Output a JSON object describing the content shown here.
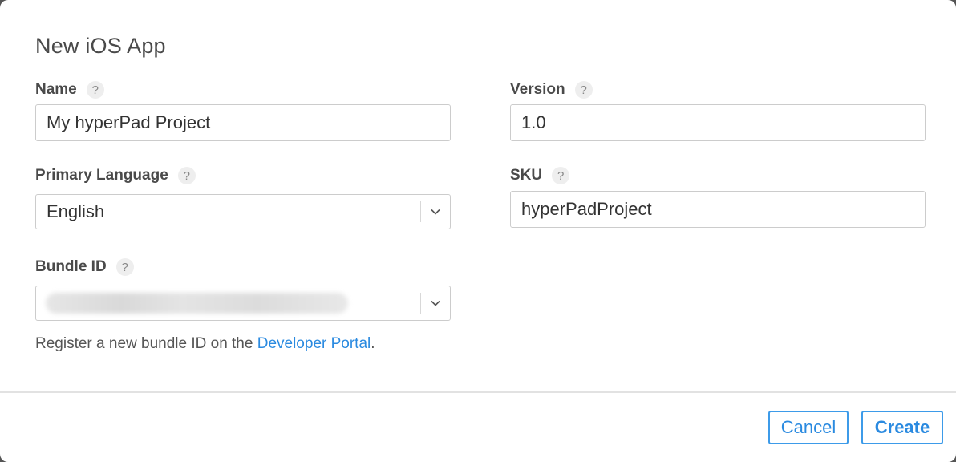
{
  "dialog": {
    "title": "New iOS App"
  },
  "fields": {
    "name": {
      "label": "Name",
      "help": "?",
      "value": "My hyperPad Project"
    },
    "version": {
      "label": "Version",
      "help": "?",
      "value": "1.0"
    },
    "primary_language": {
      "label": "Primary Language",
      "help": "?",
      "value": "English"
    },
    "sku": {
      "label": "SKU",
      "help": "?",
      "value": "hyperPadProject"
    },
    "bundle_id": {
      "label": "Bundle ID",
      "help": "?"
    }
  },
  "hint": {
    "prefix": "Register a new bundle ID on the ",
    "link": "Developer Portal",
    "suffix": "."
  },
  "footer": {
    "cancel_label": "Cancel",
    "create_label": "Create"
  },
  "colors": {
    "accent": "#2a8ae0",
    "border": "#cccccc",
    "text": "#4a4a4a"
  },
  "icons": {
    "help": "question-mark-icon",
    "select": "chevron-down-icon"
  }
}
